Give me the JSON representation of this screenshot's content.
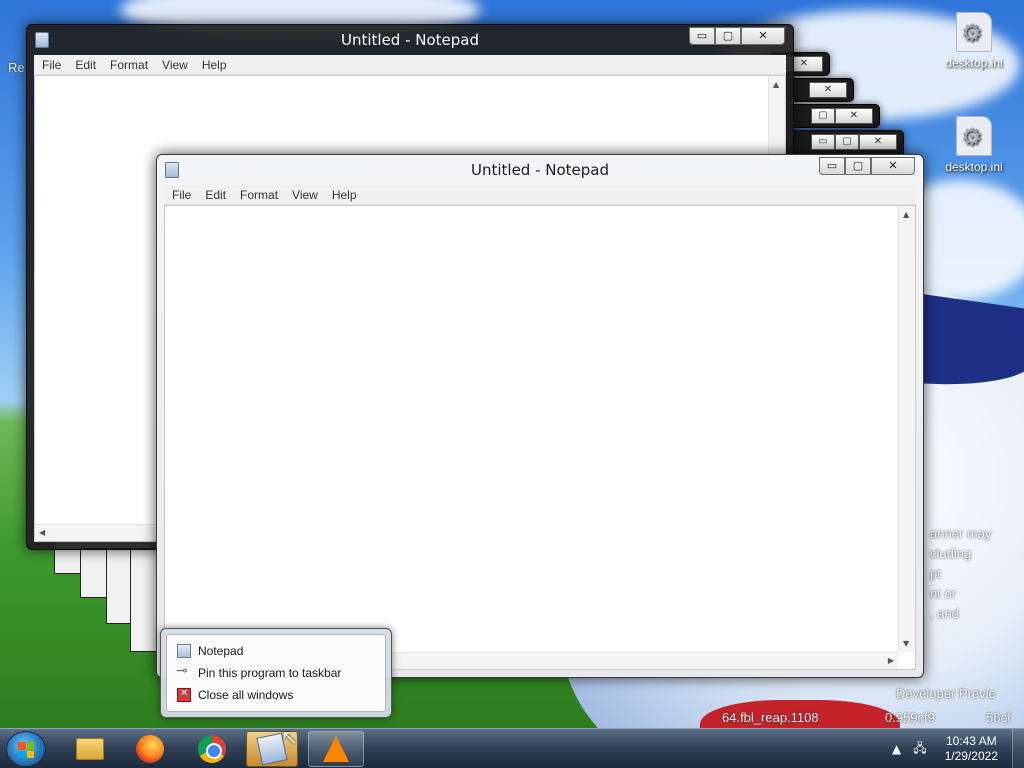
{
  "desktop": {
    "icons": [
      {
        "label": "desktop.ini"
      },
      {
        "label": "desktop.ini"
      }
    ],
    "recycle_partial": "Re",
    "watermark_lines": [
      "anner may",
      "cluding",
      "pt",
      "nt or",
      ", and"
    ],
    "build_line_1": "Developer Previe",
    "build_line_2": "64.fbl_reap.1108",
    "build_line_3": "0.959cf9",
    "build_line_4": "56cf"
  },
  "back_window": {
    "title": "Untitled - Notepad",
    "menu": [
      "File",
      "Edit",
      "Format",
      "View",
      "Help"
    ]
  },
  "front_window": {
    "title": "Untitled - Notepad",
    "menu": [
      "File",
      "Edit",
      "Format",
      "View",
      "Help"
    ]
  },
  "caption_glyphs": {
    "minimize": "▭",
    "maximize": "▢",
    "close": "✕"
  },
  "jumplist": {
    "items": [
      {
        "label": "Notepad",
        "icon": "notepad-icon"
      },
      {
        "label": "Pin this program to taskbar",
        "icon": "pin-icon"
      },
      {
        "label": "Close all windows",
        "icon": "close-window-icon"
      }
    ]
  },
  "taskbar": {
    "apps": [
      "File Explorer",
      "Firefox",
      "Chrome",
      "Notepad",
      "VLC"
    ],
    "clock_time": "10:43 AM",
    "clock_date": "1/29/2022",
    "tray_up_arrow": "▲",
    "tray_network": "🖧"
  },
  "colors": {
    "taskbar": "#2f3f55",
    "active_taskbar_btn": "#d89628",
    "close_red": "#d63a3a"
  }
}
